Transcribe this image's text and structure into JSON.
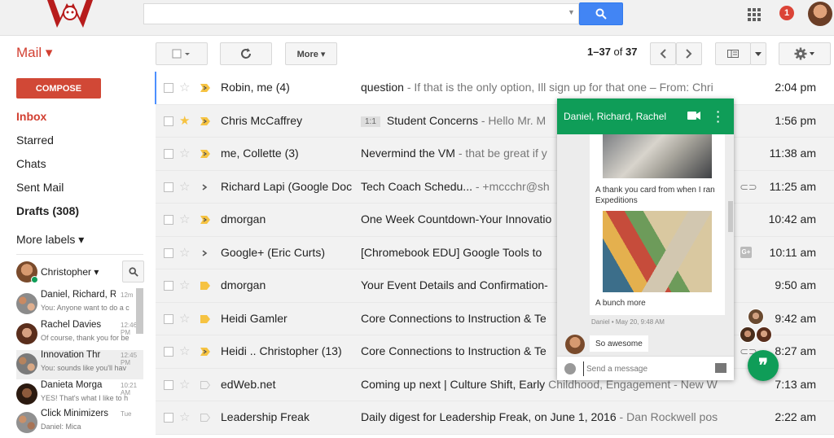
{
  "header": {
    "search_value": "",
    "notification_count": "1"
  },
  "toolbar": {
    "mail_label": "Mail ▾",
    "more_label": "More ▾",
    "pagination_range": "1–37",
    "pagination_of": " of ",
    "pagination_total": "37"
  },
  "nav": {
    "compose_label": "COMPOSE",
    "items": [
      {
        "label": "Inbox"
      },
      {
        "label": "Starred"
      },
      {
        "label": "Chats"
      },
      {
        "label": "Sent Mail"
      },
      {
        "label": "Drafts (308)"
      }
    ],
    "more_labels": "More labels ▾"
  },
  "hangouts": {
    "user_name": "Christopher ▾",
    "conversations": [
      {
        "name": "Daniel, Richard, R",
        "time": "12m",
        "message": "You: Anyone want to do a c"
      },
      {
        "name": "Rachel Davies",
        "time": "12:46 PM",
        "message": "Of course, thank you for be"
      },
      {
        "name": "Innovation Thr",
        "time": "12:45 PM",
        "message": "You: sounds like you'll hav"
      },
      {
        "name": "Danieta Morga",
        "time": "10:21 AM",
        "message": "YES! That's what I like to h"
      },
      {
        "name": "Click Minimizers",
        "time": "Tue",
        "message": "Daniel: Mica"
      }
    ]
  },
  "emails": [
    {
      "sender": "Robin, me (4)",
      "subject": "question",
      "snippet": " - If that is the only option, Ill sign up for that one – From: Chri",
      "time": "2:04 pm",
      "starred": false,
      "important": "arrow"
    },
    {
      "sender": "Chris McCaffrey",
      "tag": "1:1",
      "subject": "Student Concerns",
      "snippet": " - Hello Mr. M",
      "time": "1:56 pm",
      "starred": true,
      "important": "arrow"
    },
    {
      "sender": "me, Collette (3)",
      "subject": "Nevermind the VM",
      "snippet": " - that be great if y",
      "time": "11:38 am",
      "starred": false,
      "important": "arrow"
    },
    {
      "sender": "Richard Lapi (Google Doc",
      "subject": "Tech Coach Schedu...",
      "snippet": " - +mccchr@sh",
      "time": "11:25 am",
      "starred": false,
      "important": "chevron",
      "attachment": true
    },
    {
      "sender": "dmorgan",
      "subject": "One Week Countdown-Your Innovatio",
      "snippet": "",
      "time": "10:42 am",
      "starred": false,
      "important": "arrow"
    },
    {
      "sender": "Google+ (Eric Curts)",
      "subject": "[Chromebook EDU] Google Tools to",
      "snippet": "",
      "time": "10:11 am",
      "starred": false,
      "important": "chevron",
      "gplus": "G+"
    },
    {
      "sender": "dmorgan",
      "subject": "Your Event Details and Confirmation-",
      "snippet": "",
      "time": "9:50 am",
      "starred": false,
      "important": "tag"
    },
    {
      "sender": "Heidi Gamler",
      "subject": "Core Connections to Instruction & Te",
      "snippet": "",
      "time": "9:42 am",
      "starred": false,
      "important": "tag"
    },
    {
      "sender": "Heidi .. Christopher (13)",
      "subject": "Core Connections to Instruction & Te",
      "snippet": "",
      "time": "8:27 am",
      "starred": false,
      "important": "arrow",
      "attachment": true
    },
    {
      "sender": "edWeb.net",
      "subject": "Coming up next | Culture Shift, Early",
      "snippet": " Childhood, Engagement - New W",
      "time": "7:13 am",
      "starred": false,
      "important": "outline"
    },
    {
      "sender": "Leadership Freak",
      "subject": "Daily digest for Leadership Freak, on June 1, 2016",
      "snippet": " - Dan Rockwell pos",
      "time": "2:22 am",
      "starred": false,
      "important": "outline"
    }
  ],
  "chat": {
    "title": "Daniel, Richard, Rachel",
    "caption1": "A thank you card from when I ran Expeditions",
    "caption2": "A bunch more",
    "meta": "Daniel • May 20, 9:48 AM",
    "reply": "So awesome",
    "input_placeholder": "Send a message"
  },
  "colors": {
    "accent_red": "#d14836",
    "hangouts_green": "#0f9d58",
    "search_blue": "#4285f4"
  },
  "icons": [
    "search-icon",
    "apps-grid-icon",
    "refresh-icon",
    "chevron-left-icon",
    "chevron-right-icon",
    "gear-icon",
    "star-icon",
    "important-marker-icon",
    "video-call-icon",
    "more-vert-icon",
    "emoji-icon",
    "image-icon",
    "hangouts-quote-icon",
    "attachment-icon"
  ]
}
